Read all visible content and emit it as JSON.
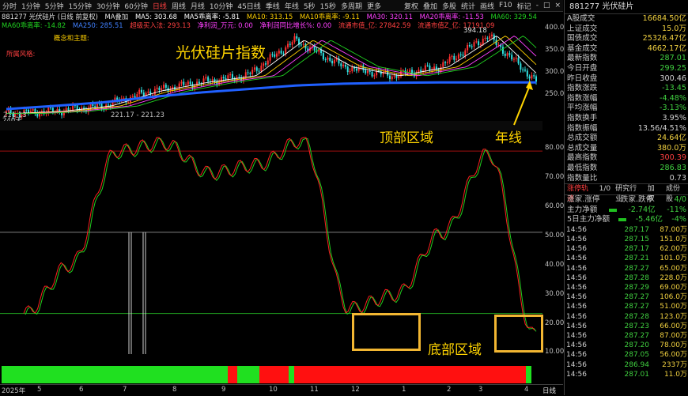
{
  "toolbar": {
    "items": [
      "分时",
      "1分钟",
      "5分钟",
      "15分钟",
      "30分钟",
      "60分钟",
      "日线",
      "周线",
      "月线",
      "10分钟",
      "45日线",
      "季线",
      "年线",
      "5秒",
      "15秒",
      "多周期",
      "更多"
    ],
    "active": "日线",
    "right_items": [
      "复权",
      "叠加",
      "多股",
      "统计",
      "画线",
      "F10",
      "标记",
      "-",
      "□",
      "×"
    ]
  },
  "legend_line1": {
    "code": "881277 光伏硅片 (日线 前复权)",
    "ma_label": "MA叠加",
    "ma5": "MA5: 303.68",
    "ma5_rate": "MA5乖离率: -5.81",
    "ma10": "MA10: 313.15",
    "ma10_rate": "MA10乖离率: -9.11",
    "ma30": "MA30: 320.11",
    "ma20_rate": "MA20乖离率: -11.53",
    "ma60": "MA60: 329.54"
  },
  "legend_line2": {
    "ma60_rate": "MA60乖离率: -14.82",
    "ma250": "MA250: 285.51",
    "super_buy": "超级买入法: 293.13",
    "net_profit": "净利润_万元: 0.00",
    "net_growth": "净利润同比增长%: 0.00",
    "float_value": "流通市值_亿: 27842.59",
    "total_value": "流通市值Z_亿: 17191.09"
  },
  "concept_label": "概念和主题:",
  "industry_label": "所属风格:",
  "chart_title_overlay": "光伏硅片指数",
  "price_high_label": "394.18",
  "price_low_label": "221.17 - 221.23",
  "price_left_label": "211.13",
  "price_axis": [
    "400.00",
    "350.00",
    "300.00",
    "250.00"
  ],
  "price_axis_current": "300",
  "mid_left_label": "240天",
  "annotations": {
    "top_zone": "顶部区域",
    "bottom_zone": "底部区域",
    "year_line": "年线"
  },
  "osc_axis": [
    "80.00",
    "70.00",
    "60.00",
    "50.00",
    "40.00",
    "30.00",
    "20.00",
    "10.00"
  ],
  "x_axis": {
    "year": "2025年",
    "months": [
      "5",
      "6",
      "7",
      "8",
      "9",
      "10",
      "11",
      "12",
      "1",
      "2",
      "3",
      "4"
    ],
    "right_label": "日线"
  },
  "right_panel": {
    "title": "881277 光伏硅片",
    "stats": [
      {
        "k": "A股成交",
        "v": "16684.50亿",
        "c": "#f0d040"
      },
      {
        "k": "上证成交",
        "v": "15.0万",
        "c": "#f0d040"
      },
      {
        "k": "国债成交",
        "v": "25326.47亿",
        "c": "#f0d040"
      },
      {
        "k": "基金成交",
        "v": "4662.17亿",
        "c": "#f0d040"
      },
      {
        "k": "最新指数",
        "v": "287.01",
        "c": "#40d040"
      },
      {
        "k": "今日开盘",
        "v": "299.25",
        "c": "#40d040"
      },
      {
        "k": "昨日收盘",
        "v": "300.46",
        "c": "#d0d0d0"
      },
      {
        "k": "指数涨跌",
        "v": "-13.45",
        "c": "#40d040"
      },
      {
        "k": "指数涨幅",
        "v": "-4.48%",
        "c": "#40d040"
      },
      {
        "k": "平均涨幅",
        "v": "-3.13%",
        "c": "#40d040"
      },
      {
        "k": "指数换手",
        "v": "3.95%",
        "c": "#d0d0d0"
      },
      {
        "k": "指数振幅",
        "v": "13.56/4.51%",
        "c": "#d0d0d0"
      },
      {
        "k": "总成交额",
        "v": "24.64亿",
        "c": "#f0d040"
      },
      {
        "k": "总成交量",
        "v": "380.0万",
        "c": "#f0d040"
      },
      {
        "k": "最高指数",
        "v": "300.39",
        "c": "#ff4040"
      },
      {
        "k": "最低指数",
        "v": "286.83",
        "c": "#40d040"
      },
      {
        "k": "指数量比",
        "v": "0.73",
        "c": "#d0d0d0"
      }
    ],
    "tabs": [
      "涨停轨迹",
      "1/0",
      "研究行业",
      "加权",
      "成份股"
    ],
    "updown": {
      "left": "涨家.涨停",
      "right": "跌家.跌停",
      "count": "4/0"
    },
    "flow": [
      {
        "k": "主力净额",
        "v": "-2.74亿",
        "pct": "-11%"
      },
      {
        "k": "5日主力净额",
        "v": "-5.46亿",
        "pct": "-4%"
      }
    ],
    "ticks": [
      {
        "t": "14:56",
        "p": "287.17",
        "v": "87.00万"
      },
      {
        "t": "14:56",
        "p": "287.15",
        "v": "151.0万"
      },
      {
        "t": "14:56",
        "p": "287.17",
        "v": "62.00万"
      },
      {
        "t": "14:56",
        "p": "287.21",
        "v": "101.0万"
      },
      {
        "t": "14:56",
        "p": "287.27",
        "v": "65.00万"
      },
      {
        "t": "14:56",
        "p": "287.28",
        "v": "228.0万"
      },
      {
        "t": "14:56",
        "p": "287.29",
        "v": "69.00万"
      },
      {
        "t": "14:56",
        "p": "287.27",
        "v": "106.0万"
      },
      {
        "t": "14:56",
        "p": "287.27",
        "v": "51.00万"
      },
      {
        "t": "14:56",
        "p": "287.28",
        "v": "123.0万"
      },
      {
        "t": "14:56",
        "p": "287.23",
        "v": "66.00万"
      },
      {
        "t": "14:56",
        "p": "287.27",
        "v": "87.00万"
      },
      {
        "t": "14:56",
        "p": "287.20",
        "v": "78.00万"
      },
      {
        "t": "14:56",
        "p": "287.05",
        "v": "56.00万"
      },
      {
        "t": "14:56",
        "p": "286.94",
        "v": "2337万"
      },
      {
        "t": "14:56",
        "p": "287.01",
        "v": "11.0万"
      }
    ]
  },
  "colors": {
    "up": "#ff3030",
    "down": "#30e0e0",
    "ma5": "#ffffff",
    "ma10": "#ffd000",
    "ma30": "#ff40ff",
    "ma60": "#20d020",
    "ma250": "#2060ff",
    "osc_red": "#ff2020",
    "osc_green": "#20d020",
    "accent": "#ffd400"
  },
  "chart_data": [
    {
      "type": "line",
      "title": "光伏硅片指数",
      "x": [
        "2025-05",
        "2025-06",
        "2025-07",
        "2025-08",
        "2025-09",
        "2025-10",
        "2025-11",
        "2025-12",
        "2026-01",
        "2026-02",
        "2026-03",
        "2026-04"
      ],
      "series": [
        {
          "name": "881277",
          "values": [
            215,
            220,
            232,
            265,
            285,
            300,
            380,
            320,
            300,
            320,
            390,
            287
          ]
        },
        {
          "name": "MA250",
          "values": [
            225,
            232,
            240,
            252,
            262,
            270,
            278,
            282,
            284,
            285,
            285,
            285
          ]
        }
      ],
      "ylim": [
        200,
        410
      ]
    },
    {
      "type": "line",
      "x": [
        "5",
        "6",
        "7",
        "8",
        "9",
        "10",
        "11",
        "12",
        "1",
        "2",
        "3",
        "4"
      ],
      "series": [
        {
          "values": [
            20,
            38,
            80,
            83,
            72,
            75,
            84,
            22,
            27,
            50,
            79,
            12
          ]
        }
      ],
      "ylim": [
        5,
        85
      ],
      "reference_lines": [
        80,
        50,
        20
      ]
    }
  ]
}
